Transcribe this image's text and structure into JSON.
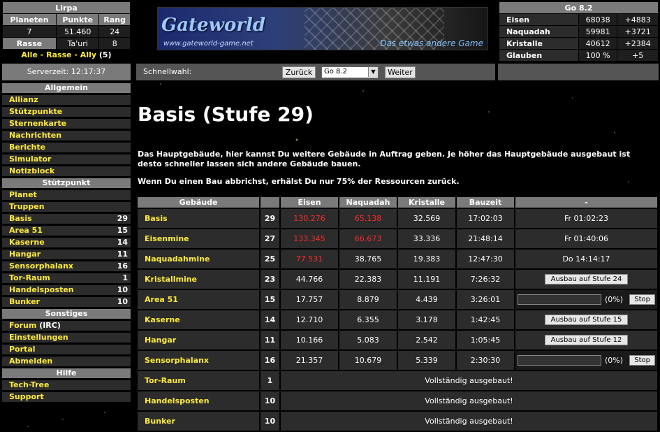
{
  "player": {
    "name": "Lirpa",
    "headers": [
      "Planeten",
      "Punkte",
      "Rang"
    ],
    "values": [
      "7",
      "51.460",
      "24"
    ],
    "race_label": "Rasse",
    "race_value": "Ta'uri",
    "race_rank": "8",
    "links": "Alle - Rasse - Ally",
    "links_count": "(5)"
  },
  "banner": {
    "logo": "Gateworld",
    "url": "www.gateworld-game.net",
    "slogan": "Das etwas andere Game"
  },
  "resources": {
    "planet": "Go 8.2",
    "rows": [
      {
        "name": "Eisen",
        "value": "68038",
        "delta": "+4883"
      },
      {
        "name": "Naquadah",
        "value": "59981",
        "delta": "+3721"
      },
      {
        "name": "Kristalle",
        "value": "40612",
        "delta": "+2384"
      },
      {
        "name": "Glauben",
        "value": "100 %",
        "delta": "+5"
      }
    ]
  },
  "server_time": "Serverzeit: 12:17:37",
  "quick": {
    "label": "Schnellwahl:",
    "back": "Zurück",
    "selected": "Go 8.2",
    "next": "Weiter"
  },
  "sidebar": {
    "sections": [
      {
        "title": "Allgemein",
        "items": [
          {
            "label": "Allianz"
          },
          {
            "label": "Stützpunkte"
          },
          {
            "label": "Sternenkarte"
          },
          {
            "label": "Nachrichten"
          },
          {
            "label": "Berichte"
          },
          {
            "label": "Simulator"
          },
          {
            "label": "Notizblock"
          }
        ]
      },
      {
        "title": "Stützpunkt",
        "items": [
          {
            "label": "Planet",
            "num": ""
          },
          {
            "label": "Truppen",
            "num": ""
          },
          {
            "label": "Basis",
            "num": "29"
          },
          {
            "label": "Area 51",
            "num": "15"
          },
          {
            "label": "Kaserne",
            "num": "14"
          },
          {
            "label": "Hangar",
            "num": "11"
          },
          {
            "label": "Sensorphalanx",
            "num": "16"
          },
          {
            "label": "Tor-Raum",
            "num": "1"
          },
          {
            "label": "Handelsposten",
            "num": "10"
          },
          {
            "label": "Bunker",
            "num": "10"
          }
        ]
      },
      {
        "title": "Sonstiges",
        "items": [
          {
            "label": "Forum",
            "extra": "(IRC)"
          },
          {
            "label": "Einstellungen"
          },
          {
            "label": "Portal"
          },
          {
            "label": "Abmelden"
          }
        ]
      },
      {
        "title": "Hilfe",
        "items": [
          {
            "label": "Tech-Tree"
          },
          {
            "label": "Support"
          }
        ]
      }
    ]
  },
  "main": {
    "title": "Basis (Stufe 29)",
    "desc": "Das Hauptgebäude, hier kannst Du weitere Gebäude in Auftrag geben. Je höher das Hauptgebäude ausgebaut ist desto schneller lassen sich andere Gebäude bauen.",
    "desc2": "Wenn Du einen Bau abbrichst, erhälst Du nur 75% der Ressourcen zurück.",
    "columns": [
      "Gebäude",
      "",
      "Eisen",
      "Naquadah",
      "Kristalle",
      "Bauzeit",
      "-"
    ],
    "buildings": [
      {
        "name": "Basis",
        "level": "29",
        "eisen": "130.276",
        "naq": "65.138",
        "kris": "32.569",
        "time": "17:02:03",
        "action": "Fr 01:02:23",
        "type": "text",
        "eisen_red": true,
        "naq_red": true
      },
      {
        "name": "Eisenmine",
        "level": "27",
        "eisen": "133.345",
        "naq": "66.673",
        "kris": "33.336",
        "time": "21:48:14",
        "action": "Fr 01:40:06",
        "type": "text",
        "eisen_red": true,
        "naq_red": true
      },
      {
        "name": "Naquadahmine",
        "level": "25",
        "eisen": "77.531",
        "naq": "38.765",
        "kris": "19.383",
        "time": "12:47:30",
        "action": "Do 14:14:17",
        "type": "text",
        "eisen_red": true,
        "naq_red": false
      },
      {
        "name": "Kristallmine",
        "level": "23",
        "eisen": "44.766",
        "naq": "22.383",
        "kris": "11.191",
        "time": "7:26:32",
        "action": "Ausbau auf Stufe 24",
        "type": "button"
      },
      {
        "name": "Area 51",
        "level": "15",
        "eisen": "17.757",
        "naq": "8.879",
        "kris": "4.439",
        "time": "3:26:01",
        "action": "(0%)",
        "stop": "Stop",
        "progress": 0,
        "type": "progress"
      },
      {
        "name": "Kaserne",
        "level": "14",
        "eisen": "12.710",
        "naq": "6.355",
        "kris": "3.178",
        "time": "1:42:45",
        "action": "Ausbau auf Stufe 15",
        "type": "button"
      },
      {
        "name": "Hangar",
        "level": "11",
        "eisen": "10.166",
        "naq": "5.083",
        "kris": "2.542",
        "time": "1:05:45",
        "action": "Ausbau auf Stufe 12",
        "type": "button"
      },
      {
        "name": "Sensorphalanx",
        "level": "16",
        "eisen": "21.357",
        "naq": "10.679",
        "kris": "5.339",
        "time": "2:30:30",
        "action": "(0%)",
        "stop": "Stop",
        "progress": 0,
        "type": "progress"
      },
      {
        "name": "Tor-Raum",
        "level": "1",
        "full": "Vollständig ausgebaut!",
        "type": "full"
      },
      {
        "name": "Handelsposten",
        "level": "10",
        "full": "Vollständig ausgebaut!",
        "type": "full"
      },
      {
        "name": "Bunker",
        "level": "10",
        "full": "Vollständig ausgebaut!",
        "type": "full"
      }
    ]
  }
}
